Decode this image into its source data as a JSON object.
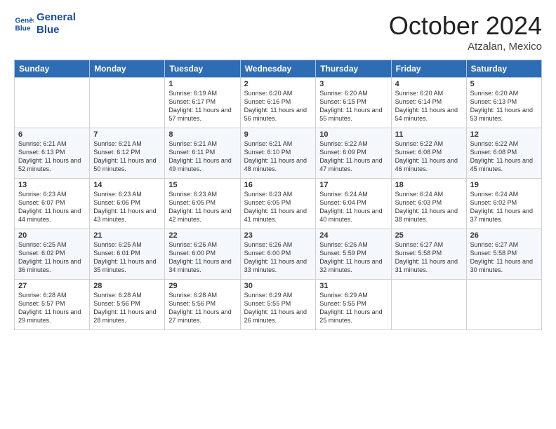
{
  "logo": {
    "line1": "General",
    "line2": "Blue"
  },
  "title": "October 2024",
  "location": "Atzalan, Mexico",
  "days_header": [
    "Sunday",
    "Monday",
    "Tuesday",
    "Wednesday",
    "Thursday",
    "Friday",
    "Saturday"
  ],
  "weeks": [
    [
      {
        "day": "",
        "sunrise": "",
        "sunset": "",
        "daylight": ""
      },
      {
        "day": "",
        "sunrise": "",
        "sunset": "",
        "daylight": ""
      },
      {
        "day": "1",
        "sunrise": "Sunrise: 6:19 AM",
        "sunset": "Sunset: 6:17 PM",
        "daylight": "Daylight: 11 hours and 57 minutes."
      },
      {
        "day": "2",
        "sunrise": "Sunrise: 6:20 AM",
        "sunset": "Sunset: 6:16 PM",
        "daylight": "Daylight: 11 hours and 56 minutes."
      },
      {
        "day": "3",
        "sunrise": "Sunrise: 6:20 AM",
        "sunset": "Sunset: 6:15 PM",
        "daylight": "Daylight: 11 hours and 55 minutes."
      },
      {
        "day": "4",
        "sunrise": "Sunrise: 6:20 AM",
        "sunset": "Sunset: 6:14 PM",
        "daylight": "Daylight: 11 hours and 54 minutes."
      },
      {
        "day": "5",
        "sunrise": "Sunrise: 6:20 AM",
        "sunset": "Sunset: 6:13 PM",
        "daylight": "Daylight: 11 hours and 53 minutes."
      }
    ],
    [
      {
        "day": "6",
        "sunrise": "Sunrise: 6:21 AM",
        "sunset": "Sunset: 6:13 PM",
        "daylight": "Daylight: 11 hours and 52 minutes."
      },
      {
        "day": "7",
        "sunrise": "Sunrise: 6:21 AM",
        "sunset": "Sunset: 6:12 PM",
        "daylight": "Daylight: 11 hours and 50 minutes."
      },
      {
        "day": "8",
        "sunrise": "Sunrise: 6:21 AM",
        "sunset": "Sunset: 6:11 PM",
        "daylight": "Daylight: 11 hours and 49 minutes."
      },
      {
        "day": "9",
        "sunrise": "Sunrise: 6:21 AM",
        "sunset": "Sunset: 6:10 PM",
        "daylight": "Daylight: 11 hours and 48 minutes."
      },
      {
        "day": "10",
        "sunrise": "Sunrise: 6:22 AM",
        "sunset": "Sunset: 6:09 PM",
        "daylight": "Daylight: 11 hours and 47 minutes."
      },
      {
        "day": "11",
        "sunrise": "Sunrise: 6:22 AM",
        "sunset": "Sunset: 6:08 PM",
        "daylight": "Daylight: 11 hours and 46 minutes."
      },
      {
        "day": "12",
        "sunrise": "Sunrise: 6:22 AM",
        "sunset": "Sunset: 6:08 PM",
        "daylight": "Daylight: 11 hours and 45 minutes."
      }
    ],
    [
      {
        "day": "13",
        "sunrise": "Sunrise: 6:23 AM",
        "sunset": "Sunset: 6:07 PM",
        "daylight": "Daylight: 11 hours and 44 minutes."
      },
      {
        "day": "14",
        "sunrise": "Sunrise: 6:23 AM",
        "sunset": "Sunset: 6:06 PM",
        "daylight": "Daylight: 11 hours and 43 minutes."
      },
      {
        "day": "15",
        "sunrise": "Sunrise: 6:23 AM",
        "sunset": "Sunset: 6:05 PM",
        "daylight": "Daylight: 11 hours and 42 minutes."
      },
      {
        "day": "16",
        "sunrise": "Sunrise: 6:23 AM",
        "sunset": "Sunset: 6:05 PM",
        "daylight": "Daylight: 11 hours and 41 minutes."
      },
      {
        "day": "17",
        "sunrise": "Sunrise: 6:24 AM",
        "sunset": "Sunset: 6:04 PM",
        "daylight": "Daylight: 11 hours and 40 minutes."
      },
      {
        "day": "18",
        "sunrise": "Sunrise: 6:24 AM",
        "sunset": "Sunset: 6:03 PM",
        "daylight": "Daylight: 11 hours and 38 minutes."
      },
      {
        "day": "19",
        "sunrise": "Sunrise: 6:24 AM",
        "sunset": "Sunset: 6:02 PM",
        "daylight": "Daylight: 11 hours and 37 minutes."
      }
    ],
    [
      {
        "day": "20",
        "sunrise": "Sunrise: 6:25 AM",
        "sunset": "Sunset: 6:02 PM",
        "daylight": "Daylight: 11 hours and 36 minutes."
      },
      {
        "day": "21",
        "sunrise": "Sunrise: 6:25 AM",
        "sunset": "Sunset: 6:01 PM",
        "daylight": "Daylight: 11 hours and 35 minutes."
      },
      {
        "day": "22",
        "sunrise": "Sunrise: 6:26 AM",
        "sunset": "Sunset: 6:00 PM",
        "daylight": "Daylight: 11 hours and 34 minutes."
      },
      {
        "day": "23",
        "sunrise": "Sunrise: 6:26 AM",
        "sunset": "Sunset: 6:00 PM",
        "daylight": "Daylight: 11 hours and 33 minutes."
      },
      {
        "day": "24",
        "sunrise": "Sunrise: 6:26 AM",
        "sunset": "Sunset: 5:59 PM",
        "daylight": "Daylight: 11 hours and 32 minutes."
      },
      {
        "day": "25",
        "sunrise": "Sunrise: 6:27 AM",
        "sunset": "Sunset: 5:58 PM",
        "daylight": "Daylight: 11 hours and 31 minutes."
      },
      {
        "day": "26",
        "sunrise": "Sunrise: 6:27 AM",
        "sunset": "Sunset: 5:58 PM",
        "daylight": "Daylight: 11 hours and 30 minutes."
      }
    ],
    [
      {
        "day": "27",
        "sunrise": "Sunrise: 6:28 AM",
        "sunset": "Sunset: 5:57 PM",
        "daylight": "Daylight: 11 hours and 29 minutes."
      },
      {
        "day": "28",
        "sunrise": "Sunrise: 6:28 AM",
        "sunset": "Sunset: 5:56 PM",
        "daylight": "Daylight: 11 hours and 28 minutes."
      },
      {
        "day": "29",
        "sunrise": "Sunrise: 6:28 AM",
        "sunset": "Sunset: 5:56 PM",
        "daylight": "Daylight: 11 hours and 27 minutes."
      },
      {
        "day": "30",
        "sunrise": "Sunrise: 6:29 AM",
        "sunset": "Sunset: 5:55 PM",
        "daylight": "Daylight: 11 hours and 26 minutes."
      },
      {
        "day": "31",
        "sunrise": "Sunrise: 6:29 AM",
        "sunset": "Sunset: 5:55 PM",
        "daylight": "Daylight: 11 hours and 25 minutes."
      },
      {
        "day": "",
        "sunrise": "",
        "sunset": "",
        "daylight": ""
      },
      {
        "day": "",
        "sunrise": "",
        "sunset": "",
        "daylight": ""
      }
    ]
  ]
}
